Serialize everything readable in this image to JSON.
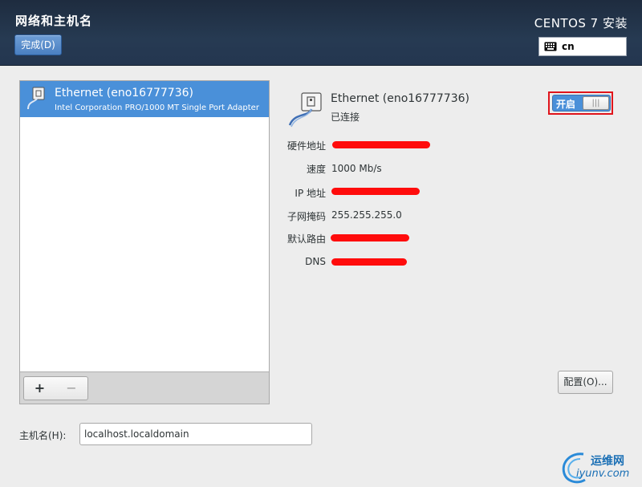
{
  "header": {
    "title": "网络和主机名",
    "done_label": "完成(D)",
    "product": "CENTOS 7 安装",
    "keyboard_layout": "cn"
  },
  "devices": [
    {
      "name": "Ethernet (eno16777736)",
      "description": "Intel Corporation PRO/1000 MT Single Port Adapter",
      "selected": true
    }
  ],
  "list_toolbar": {
    "add_label": "+",
    "remove_label": "−"
  },
  "detail": {
    "name": "Ethernet (eno16777736)",
    "status": "已连接",
    "toggle_label": "开启",
    "toggle_on": true,
    "properties": [
      {
        "label": "硬件地址",
        "value": ""
      },
      {
        "label": "速度",
        "value": "1000 Mb/s"
      },
      {
        "label": "IP 地址",
        "value": ""
      },
      {
        "label": "子网掩码",
        "value": "255.255.255.0"
      },
      {
        "label": "默认路由",
        "value": ""
      },
      {
        "label": "DNS",
        "value": ""
      }
    ],
    "configure_label": "配置(O)..."
  },
  "hostname": {
    "label": "主机名(H):",
    "value": "localhost.localdomain"
  },
  "watermark": {
    "cn": "运维网",
    "en": "iyunv.com"
  },
  "colors": {
    "header_bg": "#243650",
    "accent": "#4a90d9",
    "highlight_frame": "#e0141b",
    "redaction": "#ff0c0c"
  }
}
